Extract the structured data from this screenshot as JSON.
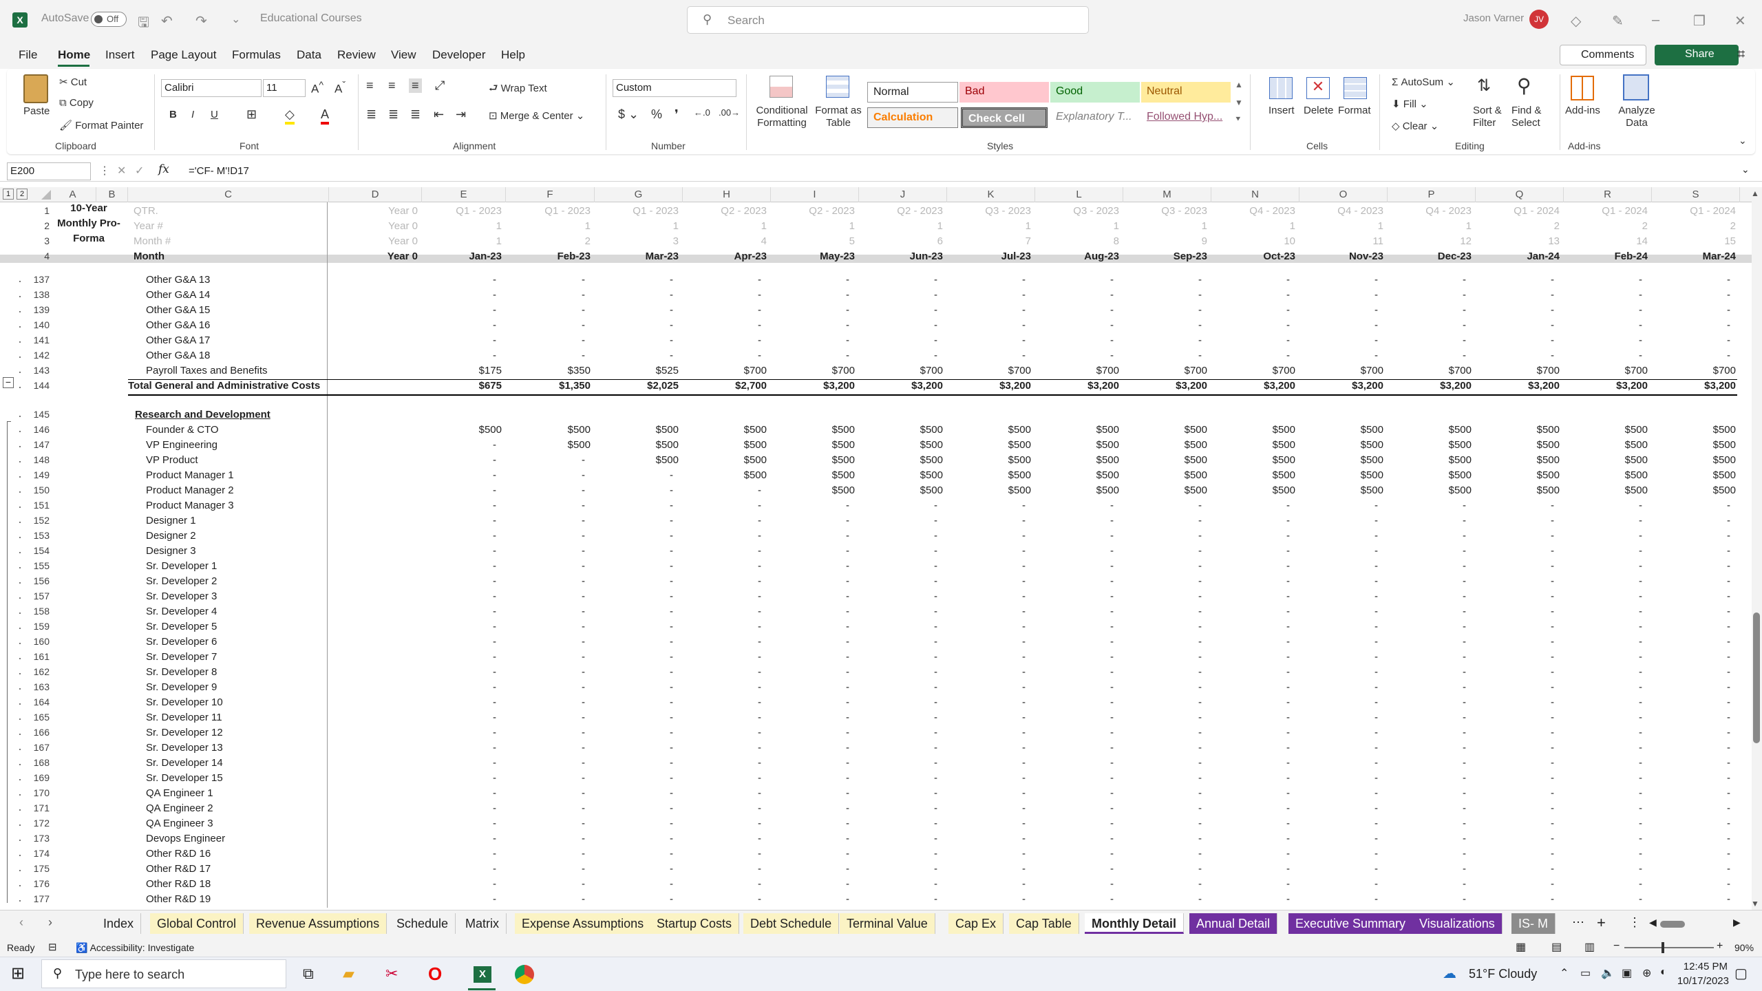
{
  "title_bar": {
    "autosave_label": "AutoSave",
    "autosave_state": "Off",
    "file_name": "Educational Courses",
    "search_placeholder": "Search",
    "user_name": "Jason Varner",
    "user_initials": "JV"
  },
  "menu": [
    "File",
    "Home",
    "Insert",
    "Page Layout",
    "Formulas",
    "Data",
    "Review",
    "View",
    "Developer",
    "Help"
  ],
  "menu_active": "Home",
  "comments_label": "Comments",
  "share_label": "Share",
  "ribbon": {
    "clipboard": {
      "paste": "Paste",
      "cut": "Cut",
      "copy": "Copy",
      "format_painter": "Format Painter",
      "group": "Clipboard"
    },
    "font": {
      "name": "Calibri",
      "size": "11",
      "group": "Font"
    },
    "alignment": {
      "wrap": "Wrap Text",
      "merge": "Merge & Center",
      "group": "Alignment"
    },
    "number": {
      "format": "Custom",
      "group": "Number"
    },
    "styles": {
      "cond": "Conditional Formatting",
      "fmt_table": "Format as Table",
      "normal": "Normal",
      "bad": "Bad",
      "good": "Good",
      "neutral": "Neutral",
      "calculation": "Calculation",
      "check": "Check Cell",
      "explanatory": "Explanatory T...",
      "followed": "Followed Hyp...",
      "group": "Styles"
    },
    "cells": {
      "insert": "Insert",
      "delete": "Delete",
      "format": "Format",
      "group": "Cells"
    },
    "editing": {
      "autosum": "AutoSum",
      "fill": "Fill",
      "clear": "Clear",
      "sort": "Sort & Filter",
      "find": "Find & Select",
      "group": "Editing"
    },
    "addins": {
      "addins": "Add-ins",
      "analyze": "Analyze Data",
      "group": "Add-ins"
    }
  },
  "formula_bar": {
    "name_box": "E200",
    "fx": "fx",
    "formula": "='CF- M'!D17"
  },
  "columns": [
    "A",
    "B",
    "C",
    "D",
    "E",
    "F",
    "G",
    "H",
    "I",
    "J",
    "K",
    "L",
    "M",
    "N",
    "O",
    "P",
    "Q",
    "R",
    "S"
  ],
  "header_block": {
    "a_label": [
      "10-Year",
      "Monthly Pro-",
      "Forma"
    ],
    "row_labels": [
      "QTR.",
      "Year #",
      "Month #",
      "Month"
    ],
    "d_values": [
      "Year 0",
      "Year 0",
      "Year 0",
      "Year 0"
    ],
    "qtr": [
      "Q1 - 2023",
      "Q1 - 2023",
      "Q1 - 2023",
      "Q2 - 2023",
      "Q2 - 2023",
      "Q2 - 2023",
      "Q3 - 2023",
      "Q3 - 2023",
      "Q3 - 2023",
      "Q4 - 2023",
      "Q4 - 2023",
      "Q4 - 2023",
      "Q1 - 2024",
      "Q1 - 2024",
      "Q1 - 2024"
    ],
    "year": [
      "1",
      "1",
      "1",
      "1",
      "1",
      "1",
      "1",
      "1",
      "1",
      "1",
      "1",
      "1",
      "2",
      "2",
      "2"
    ],
    "month_num": [
      "1",
      "2",
      "3",
      "4",
      "5",
      "6",
      "7",
      "8",
      "9",
      "10",
      "11",
      "12",
      "13",
      "14",
      "15"
    ],
    "months": [
      "Jan-23",
      "Feb-23",
      "Mar-23",
      "Apr-23",
      "May-23",
      "Jun-23",
      "Jul-23",
      "Aug-23",
      "Sep-23",
      "Oct-23",
      "Nov-23",
      "Dec-23",
      "Jan-24",
      "Feb-24",
      "Mar-24"
    ]
  },
  "rows": [
    {
      "n": "137",
      "label": "Other G&A 13",
      "vals": [
        "-",
        "-",
        "-",
        "-",
        "-",
        "-",
        "-",
        "-",
        "-",
        "-",
        "-",
        "-",
        "-",
        "-",
        "-"
      ]
    },
    {
      "n": "138",
      "label": "Other G&A 14",
      "vals": [
        "-",
        "-",
        "-",
        "-",
        "-",
        "-",
        "-",
        "-",
        "-",
        "-",
        "-",
        "-",
        "-",
        "-",
        "-"
      ]
    },
    {
      "n": "139",
      "label": "Other G&A 15",
      "vals": [
        "-",
        "-",
        "-",
        "-",
        "-",
        "-",
        "-",
        "-",
        "-",
        "-",
        "-",
        "-",
        "-",
        "-",
        "-"
      ]
    },
    {
      "n": "140",
      "label": "Other G&A 16",
      "vals": [
        "-",
        "-",
        "-",
        "-",
        "-",
        "-",
        "-",
        "-",
        "-",
        "-",
        "-",
        "-",
        "-",
        "-",
        "-"
      ]
    },
    {
      "n": "141",
      "label": "Other G&A 17",
      "vals": [
        "-",
        "-",
        "-",
        "-",
        "-",
        "-",
        "-",
        "-",
        "-",
        "-",
        "-",
        "-",
        "-",
        "-",
        "-"
      ]
    },
    {
      "n": "142",
      "label": "Other G&A 18",
      "vals": [
        "-",
        "-",
        "-",
        "-",
        "-",
        "-",
        "-",
        "-",
        "-",
        "-",
        "-",
        "-",
        "-",
        "-",
        "-"
      ]
    },
    {
      "n": "143",
      "label": "Payroll Taxes and Benefits",
      "vals": [
        "$175",
        "$350",
        "$525",
        "$700",
        "$700",
        "$700",
        "$700",
        "$700",
        "$700",
        "$700",
        "$700",
        "$700",
        "$700",
        "$700",
        "$700"
      ]
    },
    {
      "n": "144",
      "label": "Total General and Administrative Costs",
      "bold": true,
      "total": true,
      "vals": [
        "$675",
        "$1,350",
        "$2,025",
        "$2,700",
        "$3,200",
        "$3,200",
        "$3,200",
        "$3,200",
        "$3,200",
        "$3,200",
        "$3,200",
        "$3,200",
        "$3,200",
        "$3,200",
        "$3,200"
      ]
    },
    {
      "n": "",
      "label": "",
      "vals": []
    },
    {
      "n": "145",
      "label": "Research and Development",
      "heading": true,
      "vals": []
    },
    {
      "n": "146",
      "label": "Founder & CTO",
      "vals": [
        "$500",
        "$500",
        "$500",
        "$500",
        "$500",
        "$500",
        "$500",
        "$500",
        "$500",
        "$500",
        "$500",
        "$500",
        "$500",
        "$500",
        "$500"
      ]
    },
    {
      "n": "147",
      "label": "VP Engineering",
      "vals": [
        "-",
        "$500",
        "$500",
        "$500",
        "$500",
        "$500",
        "$500",
        "$500",
        "$500",
        "$500",
        "$500",
        "$500",
        "$500",
        "$500",
        "$500"
      ]
    },
    {
      "n": "148",
      "label": "VP Product",
      "vals": [
        "-",
        "-",
        "$500",
        "$500",
        "$500",
        "$500",
        "$500",
        "$500",
        "$500",
        "$500",
        "$500",
        "$500",
        "$500",
        "$500",
        "$500"
      ]
    },
    {
      "n": "149",
      "label": "Product Manager 1",
      "vals": [
        "-",
        "-",
        "-",
        "$500",
        "$500",
        "$500",
        "$500",
        "$500",
        "$500",
        "$500",
        "$500",
        "$500",
        "$500",
        "$500",
        "$500"
      ]
    },
    {
      "n": "150",
      "label": "Product Manager 2",
      "vals": [
        "-",
        "-",
        "-",
        "-",
        "$500",
        "$500",
        "$500",
        "$500",
        "$500",
        "$500",
        "$500",
        "$500",
        "$500",
        "$500",
        "$500"
      ]
    },
    {
      "n": "151",
      "label": "Product Manager 3",
      "vals": [
        "-",
        "-",
        "-",
        "-",
        "-",
        "-",
        "-",
        "-",
        "-",
        "-",
        "-",
        "-",
        "-",
        "-",
        "-"
      ]
    },
    {
      "n": "152",
      "label": "Designer 1",
      "vals": [
        "-",
        "-",
        "-",
        "-",
        "-",
        "-",
        "-",
        "-",
        "-",
        "-",
        "-",
        "-",
        "-",
        "-",
        "-"
      ]
    },
    {
      "n": "153",
      "label": "Designer 2",
      "vals": [
        "-",
        "-",
        "-",
        "-",
        "-",
        "-",
        "-",
        "-",
        "-",
        "-",
        "-",
        "-",
        "-",
        "-",
        "-"
      ]
    },
    {
      "n": "154",
      "label": "Designer 3",
      "vals": [
        "-",
        "-",
        "-",
        "-",
        "-",
        "-",
        "-",
        "-",
        "-",
        "-",
        "-",
        "-",
        "-",
        "-",
        "-"
      ]
    },
    {
      "n": "155",
      "label": "Sr. Developer 1",
      "vals": [
        "-",
        "-",
        "-",
        "-",
        "-",
        "-",
        "-",
        "-",
        "-",
        "-",
        "-",
        "-",
        "-",
        "-",
        "-"
      ]
    },
    {
      "n": "156",
      "label": "Sr. Developer 2",
      "vals": [
        "-",
        "-",
        "-",
        "-",
        "-",
        "-",
        "-",
        "-",
        "-",
        "-",
        "-",
        "-",
        "-",
        "-",
        "-"
      ]
    },
    {
      "n": "157",
      "label": "Sr. Developer 3",
      "vals": [
        "-",
        "-",
        "-",
        "-",
        "-",
        "-",
        "-",
        "-",
        "-",
        "-",
        "-",
        "-",
        "-",
        "-",
        "-"
      ]
    },
    {
      "n": "158",
      "label": "Sr. Developer 4",
      "vals": [
        "-",
        "-",
        "-",
        "-",
        "-",
        "-",
        "-",
        "-",
        "-",
        "-",
        "-",
        "-",
        "-",
        "-",
        "-"
      ]
    },
    {
      "n": "159",
      "label": "Sr. Developer 5",
      "vals": [
        "-",
        "-",
        "-",
        "-",
        "-",
        "-",
        "-",
        "-",
        "-",
        "-",
        "-",
        "-",
        "-",
        "-",
        "-"
      ]
    },
    {
      "n": "160",
      "label": "Sr. Developer 6",
      "vals": [
        "-",
        "-",
        "-",
        "-",
        "-",
        "-",
        "-",
        "-",
        "-",
        "-",
        "-",
        "-",
        "-",
        "-",
        "-"
      ]
    },
    {
      "n": "161",
      "label": "Sr. Developer 7",
      "vals": [
        "-",
        "-",
        "-",
        "-",
        "-",
        "-",
        "-",
        "-",
        "-",
        "-",
        "-",
        "-",
        "-",
        "-",
        "-"
      ]
    },
    {
      "n": "162",
      "label": "Sr. Developer 8",
      "vals": [
        "-",
        "-",
        "-",
        "-",
        "-",
        "-",
        "-",
        "-",
        "-",
        "-",
        "-",
        "-",
        "-",
        "-",
        "-"
      ]
    },
    {
      "n": "163",
      "label": "Sr. Developer 9",
      "vals": [
        "-",
        "-",
        "-",
        "-",
        "-",
        "-",
        "-",
        "-",
        "-",
        "-",
        "-",
        "-",
        "-",
        "-",
        "-"
      ]
    },
    {
      "n": "164",
      "label": "Sr. Developer 10",
      "vals": [
        "-",
        "-",
        "-",
        "-",
        "-",
        "-",
        "-",
        "-",
        "-",
        "-",
        "-",
        "-",
        "-",
        "-",
        "-"
      ]
    },
    {
      "n": "165",
      "label": "Sr. Developer 11",
      "vals": [
        "-",
        "-",
        "-",
        "-",
        "-",
        "-",
        "-",
        "-",
        "-",
        "-",
        "-",
        "-",
        "-",
        "-",
        "-"
      ]
    },
    {
      "n": "166",
      "label": "Sr. Developer 12",
      "vals": [
        "-",
        "-",
        "-",
        "-",
        "-",
        "-",
        "-",
        "-",
        "-",
        "-",
        "-",
        "-",
        "-",
        "-",
        "-"
      ]
    },
    {
      "n": "167",
      "label": "Sr. Developer 13",
      "vals": [
        "-",
        "-",
        "-",
        "-",
        "-",
        "-",
        "-",
        "-",
        "-",
        "-",
        "-",
        "-",
        "-",
        "-",
        "-"
      ]
    },
    {
      "n": "168",
      "label": "Sr. Developer 14",
      "vals": [
        "-",
        "-",
        "-",
        "-",
        "-",
        "-",
        "-",
        "-",
        "-",
        "-",
        "-",
        "-",
        "-",
        "-",
        "-"
      ]
    },
    {
      "n": "169",
      "label": "Sr. Developer 15",
      "vals": [
        "-",
        "-",
        "-",
        "-",
        "-",
        "-",
        "-",
        "-",
        "-",
        "-",
        "-",
        "-",
        "-",
        "-",
        "-"
      ]
    },
    {
      "n": "170",
      "label": "QA Engineer 1",
      "vals": [
        "-",
        "-",
        "-",
        "-",
        "-",
        "-",
        "-",
        "-",
        "-",
        "-",
        "-",
        "-",
        "-",
        "-",
        "-"
      ]
    },
    {
      "n": "171",
      "label": "QA Engineer 2",
      "vals": [
        "-",
        "-",
        "-",
        "-",
        "-",
        "-",
        "-",
        "-",
        "-",
        "-",
        "-",
        "-",
        "-",
        "-",
        "-"
      ]
    },
    {
      "n": "172",
      "label": "QA Engineer 3",
      "vals": [
        "-",
        "-",
        "-",
        "-",
        "-",
        "-",
        "-",
        "-",
        "-",
        "-",
        "-",
        "-",
        "-",
        "-",
        "-"
      ]
    },
    {
      "n": "173",
      "label": "Devops Engineer",
      "vals": [
        "-",
        "-",
        "-",
        "-",
        "-",
        "-",
        "-",
        "-",
        "-",
        "-",
        "-",
        "-",
        "-",
        "-",
        "-"
      ]
    },
    {
      "n": "174",
      "label": "Other R&D 16",
      "vals": [
        "-",
        "-",
        "-",
        "-",
        "-",
        "-",
        "-",
        "-",
        "-",
        "-",
        "-",
        "-",
        "-",
        "-",
        "-"
      ]
    },
    {
      "n": "175",
      "label": "Other R&D 17",
      "vals": [
        "-",
        "-",
        "-",
        "-",
        "-",
        "-",
        "-",
        "-",
        "-",
        "-",
        "-",
        "-",
        "-",
        "-",
        "-"
      ]
    },
    {
      "n": "176",
      "label": "Other R&D 18",
      "vals": [
        "-",
        "-",
        "-",
        "-",
        "-",
        "-",
        "-",
        "-",
        "-",
        "-",
        "-",
        "-",
        "-",
        "-",
        "-"
      ]
    },
    {
      "n": "177",
      "label": "Other R&D 19",
      "vals": [
        "-",
        "-",
        "-",
        "-",
        "-",
        "-",
        "-",
        "-",
        "-",
        "-",
        "-",
        "-",
        "-",
        "-",
        "-"
      ]
    }
  ],
  "sheet_tabs": [
    {
      "label": "Index",
      "color": "#f3f3f3"
    },
    {
      "label": "Global Control",
      "color": "#fbf3c4"
    },
    {
      "label": "Revenue Assumptions",
      "color": "#fbf3c4"
    },
    {
      "label": "Schedule",
      "color": "#f3f3f3"
    },
    {
      "label": "Matrix",
      "color": "#f3f3f3"
    },
    {
      "label": "Expense Assumptions",
      "color": "#fbf3c4"
    },
    {
      "label": "Startup Costs",
      "color": "#fbf3c4"
    },
    {
      "label": "Debt Schedule",
      "color": "#fbf3c4"
    },
    {
      "label": "Terminal Value",
      "color": "#fbf3c4"
    },
    {
      "label": "Cap Ex",
      "color": "#fbf3c4"
    },
    {
      "label": "Cap Table",
      "color": "#fbf3c4"
    },
    {
      "label": "Monthly Detail",
      "color": "#ffffff",
      "active": true
    },
    {
      "label": "Annual Detail",
      "color": "#7030a0"
    },
    {
      "label": "Executive Summary",
      "color": "#7030a0"
    },
    {
      "label": "Visualizations",
      "color": "#7030a0"
    },
    {
      "label": "IS- M",
      "color": "#8c8c8c"
    }
  ],
  "status": {
    "ready": "Ready",
    "accessibility": "Accessibility: Investigate",
    "zoom": "90%"
  },
  "taskbar": {
    "search_placeholder": "Type here to search",
    "weather": "51°F  Cloudy",
    "time": "12:45 PM",
    "date": "10/17/2023"
  }
}
